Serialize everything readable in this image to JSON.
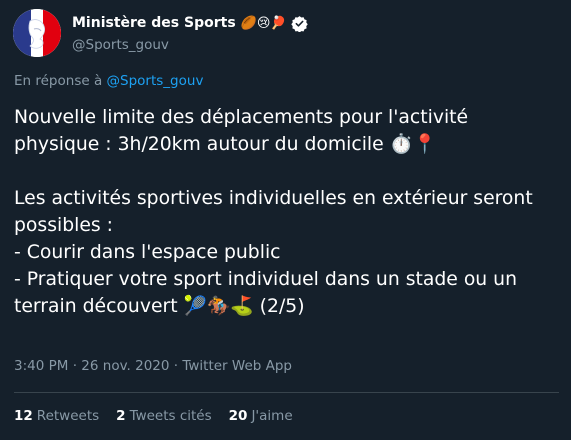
{
  "account": {
    "display_name": "Ministère des Sports",
    "name_emojis": "🏉😢🏓",
    "handle": "@Sports_gouv",
    "verified": true
  },
  "reply": {
    "prefix": "En réponse à",
    "handle": "@Sports_gouv"
  },
  "tweet": {
    "text": "Nouvelle limite des déplacements pour l'activité physique : 3h/20km autour du domicile ⏱️📍\n\nLes activités sportives individuelles en extérieur seront possibles :\n- Courir dans l'espace public\n- Pratiquer votre sport individuel dans un stade ou un terrain découvert 🎾🏇⛳ (2/5)",
    "time": "3:40 PM",
    "separator": "·",
    "date": "26 nov. 2020",
    "source": "Twitter Web App"
  },
  "stats": {
    "retweets_count": "12",
    "retweets_label": "Retweets",
    "quotes_count": "2",
    "quotes_label": "Tweets cités",
    "likes_count": "20",
    "likes_label": "J'aime"
  },
  "colors": {
    "background": "#15202b",
    "secondary_text": "#8899a6",
    "link": "#1da1f2",
    "divider": "#38444d"
  },
  "icons": {
    "avatar": "marianne-logo",
    "verified": "verified-badge-icon"
  }
}
